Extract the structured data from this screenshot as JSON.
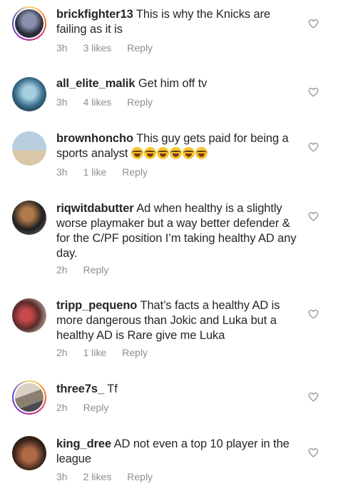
{
  "comments": [
    {
      "username": "brickfighter13",
      "text": "This is why the Knicks are failing as it is",
      "time": "3h",
      "likes": "3 likes",
      "reply": "Reply",
      "avatar_colors": [
        "#2a2d3a",
        "#8a8fb0"
      ]
    },
    {
      "username": "all_elite_malik",
      "text": "Get him off tv",
      "time": "3h",
      "likes": "4 likes",
      "reply": "Reply",
      "avatar_colors": [
        "#3a6e8c",
        "#7fb0c7"
      ]
    },
    {
      "username": "brownhoncho",
      "text": "This guy gets paid for being a sports analyst",
      "emoji_count": 6,
      "emoji_name": "laughing-tears-emoji",
      "time": "3h",
      "likes": "1 like",
      "reply": "Reply",
      "avatar_colors": [
        "#9db4c8",
        "#d9c7a8"
      ]
    },
    {
      "username": "riqwitdabutter",
      "text": "Ad when healthy is a slightly worse playmaker but a way better defender & for the C/PF position I’m taking healthy AD any day.",
      "time": "2h",
      "likes": "",
      "reply": "Reply",
      "avatar_colors": [
        "#1e1e1e",
        "#b07a4a"
      ]
    },
    {
      "username": "tripp_pequeno",
      "text": "That’s facts a healthy AD is more dangerous than Jokic and Luka but a healthy AD is Rare give me Luka",
      "time": "2h",
      "likes": "1 like",
      "reply": "Reply",
      "avatar_colors": [
        "#5a2a2a",
        "#c84a4a"
      ]
    },
    {
      "username": "three7s_",
      "text": "Tf",
      "time": "2h",
      "likes": "",
      "reply": "Reply",
      "avatar_colors": [
        "#8a7f70",
        "#d8d0c4"
      ]
    },
    {
      "username": "king_dree",
      "text": "AD not even a top 10 player in the league",
      "time": "3h",
      "likes": "2 likes",
      "reply": "Reply",
      "avatar_colors": [
        "#3b2418",
        "#b06a48"
      ]
    }
  ],
  "icons": {
    "like": "heart-outline-icon"
  }
}
